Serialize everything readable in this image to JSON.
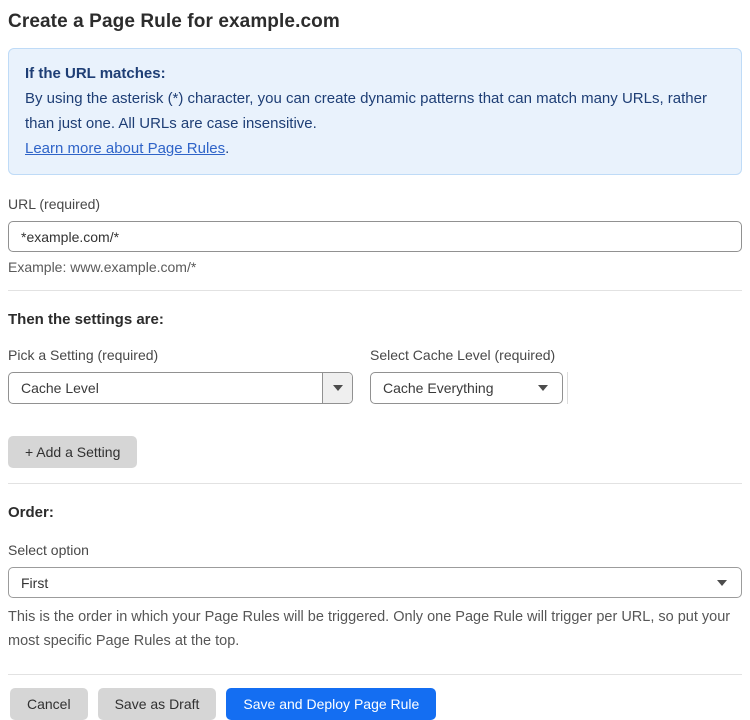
{
  "page": {
    "title": "Create a Page Rule for example.com"
  },
  "info_box": {
    "heading": "If the URL matches:",
    "body": "By using the asterisk (*) character, you can create dynamic patterns that can match many URLs, rather than just one. All URLs are case insensitive.",
    "link_text": "Learn more about Page Rules",
    "link_suffix": "."
  },
  "url_field": {
    "label": "URL (required)",
    "value": "*example.com/*",
    "example": "Example: www.example.com/*"
  },
  "settings": {
    "heading": "Then the settings are:",
    "setting_label": "Pick a Setting (required)",
    "setting_value": "Cache Level",
    "cache_label": "Select Cache Level (required)",
    "cache_value": "Cache Everything",
    "add_button_label": "+ Add a Setting"
  },
  "order": {
    "heading": "Order:",
    "label": "Select option",
    "value": "First",
    "help": "This is the order in which your Page Rules will be triggered. Only one Page Rule will trigger per URL, so put your most specific Page Rules at the top."
  },
  "footer": {
    "cancel_label": "Cancel",
    "save_draft_label": "Save as Draft",
    "save_deploy_label": "Save and Deploy Page Rule"
  },
  "colors": {
    "accent_blue": "#146ef2",
    "info_bg": "#e9f2fc",
    "info_border": "#bfdbf7",
    "info_text": "#1e3e75",
    "link_blue": "#2f64c8",
    "button_gray": "#d6d6d6"
  }
}
